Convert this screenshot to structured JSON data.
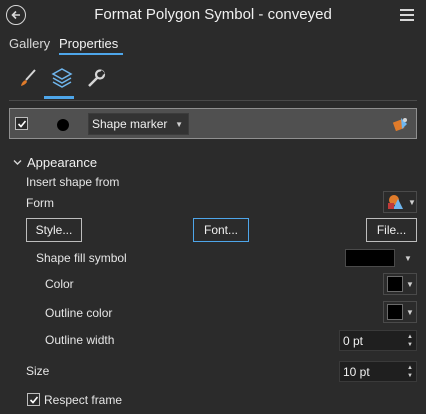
{
  "header": {
    "title": "Format Polygon Symbol - conveyed",
    "back_icon": "back-arrow-icon",
    "menu_icon": "hamburger-menu-icon"
  },
  "tabs": [
    {
      "label": "Gallery",
      "active": false
    },
    {
      "label": "Properties",
      "active": true
    }
  ],
  "toolbar": {
    "items": [
      {
        "icon": "brush-icon",
        "active": false
      },
      {
        "icon": "layers-icon",
        "active": true
      },
      {
        "icon": "wrench-icon",
        "active": false
      }
    ]
  },
  "layer": {
    "checked": true,
    "type_value": "Shape marker",
    "lock_icon": "lock-layer-icon"
  },
  "appearance": {
    "heading": "Appearance",
    "insert_shape_label": "Insert shape from",
    "form_label": "Form",
    "buttons": {
      "style": "Style...",
      "font": "Font...",
      "file": "File..."
    },
    "shape_fill_label": "Shape fill symbol",
    "color_label": "Color",
    "outline_color_label": "Outline color",
    "outline_width_label": "Outline width",
    "outline_width_value": "0 pt",
    "size_label": "Size",
    "size_value": "10 pt",
    "respect_frame_label": "Respect frame",
    "respect_frame_checked": true
  },
  "colors": {
    "accent": "#4ea6ea",
    "background": "#2b2b2b",
    "fill": "#000000"
  }
}
